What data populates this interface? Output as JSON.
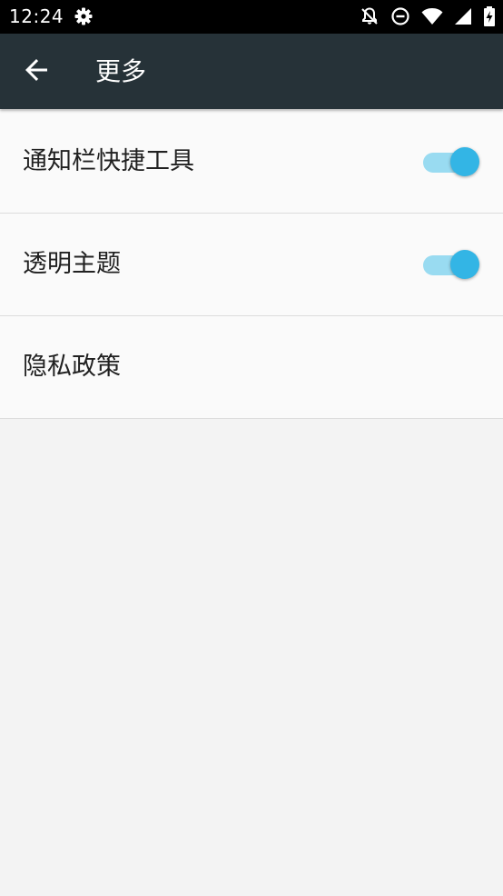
{
  "status_bar": {
    "time": "12:24",
    "icons": [
      "settings-gear-icon",
      "notifications-off-icon",
      "do-not-disturb-icon",
      "wifi-icon",
      "cellular-signal-icon",
      "battery-charging-icon"
    ]
  },
  "app_bar": {
    "back_icon": "arrow-back-icon",
    "title": "更多"
  },
  "settings": {
    "items": [
      {
        "label": "通知栏快捷工具",
        "toggle": true,
        "toggle_on": true
      },
      {
        "label": "透明主题",
        "toggle": true,
        "toggle_on": true
      },
      {
        "label": "隐私政策",
        "toggle": false
      }
    ]
  },
  "colors": {
    "status_bar": "#000000",
    "app_bar": "#263238",
    "list_background": "#fafafa",
    "page_background": "#f3f3f3",
    "toggle_thumb": "#33b5e5",
    "toggle_track": "#99dbf1"
  }
}
